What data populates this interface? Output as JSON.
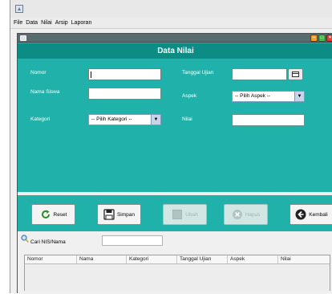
{
  "menu": {
    "items": [
      "File",
      "Data",
      "Nilai",
      "Arsip",
      "Laporan"
    ]
  },
  "frame": {
    "header_title": "Data Nilai"
  },
  "form": {
    "nomor_label": "Nomor",
    "nomor_value": "",
    "nama_siswa_label": "Nama Siswa",
    "nama_siswa_value": "",
    "kategori_label": "Kategori",
    "kategori_selected": "-- Pilih Kategori --",
    "tanggal_ujian_label": "Tanggal Ujian",
    "tanggal_ujian_value": "",
    "aspek_label": "Aspek",
    "aspek_selected": "-- Pilih Aspek --",
    "nilai_label": "Nilai",
    "nilai_value": ""
  },
  "buttons": {
    "reset": "Reset",
    "simpan": "Simpan",
    "ubah": "Ubah",
    "hapus": "Hapus",
    "kembali": "Kembali"
  },
  "search": {
    "label": "Cari NIS/Nama",
    "value": ""
  },
  "table": {
    "columns": [
      "Nomor",
      "Nama",
      "Kategori",
      "Tanggal Ujian",
      "Aspek",
      "Nilai"
    ]
  },
  "colors": {
    "panel": "#20b2aa",
    "header": "#0c8c85"
  }
}
